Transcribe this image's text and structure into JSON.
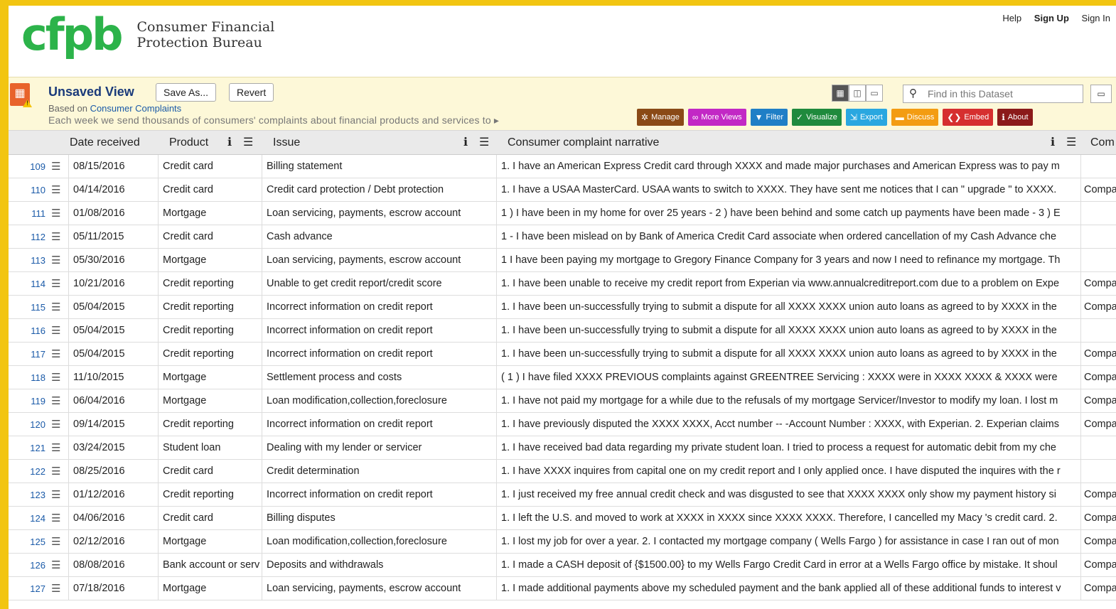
{
  "header": {
    "logo_mark": "cfpb",
    "org_line1": "Consumer Financial",
    "org_line2": "Protection Bureau",
    "links": {
      "help": "Help",
      "sign_up": "Sign Up",
      "sign_in": "Sign In"
    }
  },
  "view": {
    "title": "Unsaved View",
    "save_as": "Save As...",
    "revert": "Revert",
    "based_on_prefix": "Based on",
    "based_on_link": "Consumer Complaints",
    "description": "Each week we send thousands of consumers' complaints about financial products and services to ▸",
    "search_placeholder": "Find in this Dataset",
    "colors": {
      "accent_orange": "#e8632b",
      "title_bg": "#fdf8d8",
      "link": "#1a5aa8"
    }
  },
  "actions": [
    {
      "label": "Manage",
      "icon": "gear-icon",
      "color": "#8a4a16"
    },
    {
      "label": "More Views",
      "icon": "binoculars-icon",
      "color": "#c228c5"
    },
    {
      "label": "Filter",
      "icon": "funnel-icon",
      "color": "#1f7fc6"
    },
    {
      "label": "Visualize",
      "icon": "chart-icon",
      "color": "#1f8a3d"
    },
    {
      "label": "Export",
      "icon": "export-icon",
      "color": "#2aa7e0"
    },
    {
      "label": "Discuss",
      "icon": "speech-icon",
      "color": "#f39c12"
    },
    {
      "label": "Embed",
      "icon": "code-icon",
      "color": "#d62f2f"
    },
    {
      "label": "About",
      "icon": "info-icon",
      "color": "#8b1a1a"
    }
  ],
  "columns": {
    "date": "Date received",
    "product": "Product",
    "issue": "Issue",
    "narrative": "Consumer complaint narrative",
    "company": "Com"
  },
  "rows": [
    {
      "n": "109",
      "date": "08/15/2016",
      "product": "Credit card",
      "issue": "Billing statement",
      "narrative": "1. I have an American Express Credit card through XXXX and made major purchases and American Express was to pay m",
      "company": ""
    },
    {
      "n": "110",
      "date": "04/14/2016",
      "product": "Credit card",
      "issue": "Credit card protection / Debt protection",
      "narrative": "1. I have a USAA MasterCard. USAA wants to switch to XXXX. They have sent me notices that I can \" upgrade \" to XXXX.",
      "company": "Compa"
    },
    {
      "n": "111",
      "date": "01/08/2016",
      "product": "Mortgage",
      "issue": "Loan servicing, payments, escrow account",
      "narrative": "1 ) I have been in my home for over 25 years - 2 ) have been behind and some catch up payments have been made - 3 ) E",
      "company": ""
    },
    {
      "n": "112",
      "date": "05/11/2015",
      "product": "Credit card",
      "issue": "Cash advance",
      "narrative": "1 - I have been mislead on by Bank of America Credit Card associate when ordered cancellation of my Cash Advance che",
      "company": ""
    },
    {
      "n": "113",
      "date": "05/30/2016",
      "product": "Mortgage",
      "issue": "Loan servicing, payments, escrow account",
      "narrative": "1 I have been paying my mortgage to Gregory Finance Company for 3 years and now I need to refinance my mortgage. Th",
      "company": ""
    },
    {
      "n": "114",
      "date": "10/21/2016",
      "product": "Credit reporting",
      "issue": "Unable to get credit report/credit score",
      "narrative": "1. I have been unable to receive my credit report from Experian via www.annualcreditreport.com due to a problem on Expe",
      "company": "Compa"
    },
    {
      "n": "115",
      "date": "05/04/2015",
      "product": "Credit reporting",
      "issue": "Incorrect information on credit report",
      "narrative": "1. I have been un-successfully trying to submit a dispute for all XXXX XXXX union auto loans as agreed to by XXXX in the",
      "company": "Compa"
    },
    {
      "n": "116",
      "date": "05/04/2015",
      "product": "Credit reporting",
      "issue": "Incorrect information on credit report",
      "narrative": "1. I have been un-successfully trying to submit a dispute for all XXXX XXXX union auto loans as agreed to by XXXX in the",
      "company": ""
    },
    {
      "n": "117",
      "date": "05/04/2015",
      "product": "Credit reporting",
      "issue": "Incorrect information on credit report",
      "narrative": "1. I have been un-successfully trying to submit a dispute for all XXXX XXXX union auto loans as agreed to by XXXX in the",
      "company": "Compa"
    },
    {
      "n": "118",
      "date": "11/10/2015",
      "product": "Mortgage",
      "issue": "Settlement process and costs",
      "narrative": "( 1 ) I have filed XXXX PREVIOUS complaints against GREENTREE Servicing : XXXX were in XXXX XXXX & XXXX were",
      "company": "Compa"
    },
    {
      "n": "119",
      "date": "06/04/2016",
      "product": "Mortgage",
      "issue": "Loan modification,collection,foreclosure",
      "narrative": "1. I have not paid my mortgage for a while due to the refusals of my mortgage Servicer/Investor to modify my loan. I lost m",
      "company": "Compa"
    },
    {
      "n": "120",
      "date": "09/14/2015",
      "product": "Credit reporting",
      "issue": "Incorrect information on credit report",
      "narrative": "1. I have previously disputed the XXXX XXXX, Acct number -- -Account Number : XXXX, with Experian. 2. Experian claims",
      "company": "Compa"
    },
    {
      "n": "121",
      "date": "03/24/2015",
      "product": "Student loan",
      "issue": "Dealing with my lender or servicer",
      "narrative": "1. I have received bad data regarding my private student loan. I tried to process a request for automatic debit from my che",
      "company": ""
    },
    {
      "n": "122",
      "date": "08/25/2016",
      "product": "Credit card",
      "issue": "Credit determination",
      "narrative": "1. I have XXXX inquires from capital one on my credit report and I only applied once. I have disputed the inquires with the r",
      "company": ""
    },
    {
      "n": "123",
      "date": "01/12/2016",
      "product": "Credit reporting",
      "issue": "Incorrect information on credit report",
      "narrative": "1. I just received my free annual credit check and was disgusted to see that XXXX XXXX only show my payment history si",
      "company": "Compa"
    },
    {
      "n": "124",
      "date": "04/06/2016",
      "product": "Credit card",
      "issue": "Billing disputes",
      "narrative": "1. I left the U.S. and moved to work at XXXX in XXXX since XXXX XXXX. Therefore, I cancelled my Macy 's credit card. 2.",
      "company": "Compa"
    },
    {
      "n": "125",
      "date": "02/12/2016",
      "product": "Mortgage",
      "issue": "Loan modification,collection,foreclosure",
      "narrative": "1. I lost my job for over a year. 2. I contacted my mortgage company ( Wells Fargo ) for assistance in case I ran out of mon",
      "company": "Compa"
    },
    {
      "n": "126",
      "date": "08/08/2016",
      "product": "Bank account or serv",
      "issue": "Deposits and withdrawals",
      "narrative": "1. I made a CASH deposit of {$1500.00} to my Wells Fargo Credit Card in error at a Wells Fargo office by mistake. It shoul",
      "company": "Compa"
    },
    {
      "n": "127",
      "date": "07/18/2016",
      "product": "Mortgage",
      "issue": "Loan servicing, payments, escrow account",
      "narrative": "1. I made additional payments above my scheduled payment and the bank applied all of these additional funds to interest v",
      "company": "Compa"
    }
  ]
}
